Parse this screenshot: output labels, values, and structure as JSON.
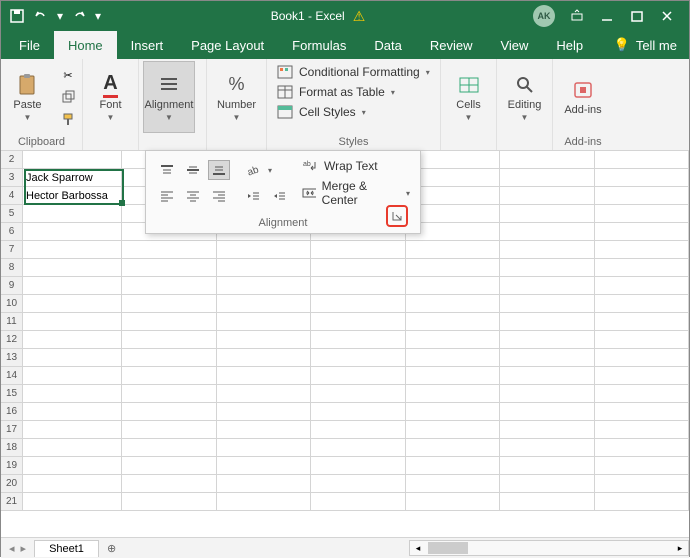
{
  "titlebar": {
    "title": "Book1 - Excel",
    "avatar": "AK"
  },
  "tabs": {
    "file": "File",
    "home": "Home",
    "insert": "Insert",
    "page_layout": "Page Layout",
    "formulas": "Formulas",
    "data": "Data",
    "review": "Review",
    "view": "View",
    "help": "Help",
    "tell_me": "Tell me"
  },
  "ribbon": {
    "clipboard": {
      "label": "Clipboard",
      "paste": "Paste"
    },
    "font": {
      "label": "Font"
    },
    "alignment": {
      "label": "Alignment"
    },
    "number": {
      "label": "Number"
    },
    "styles": {
      "label": "Styles",
      "cond_fmt": "Conditional Formatting",
      "fmt_table": "Format as Table",
      "cell_styles": "Cell Styles"
    },
    "cells": {
      "label": "Cells"
    },
    "editing": {
      "label": "Editing"
    },
    "addins": {
      "label": "Add-ins"
    }
  },
  "popout": {
    "wrap": "Wrap Text",
    "merge": "Merge & Center",
    "label": "Alignment"
  },
  "cells": {
    "A3": "Jack Sparrow",
    "A4": "Hector Barbossa"
  },
  "row_headers": [
    "2",
    "3",
    "4",
    "5",
    "6",
    "7",
    "8",
    "9",
    "10",
    "11",
    "12",
    "13",
    "14",
    "15",
    "16",
    "17",
    "18",
    "19",
    "20",
    "21"
  ],
  "sheet": {
    "tab1": "Sheet1"
  }
}
